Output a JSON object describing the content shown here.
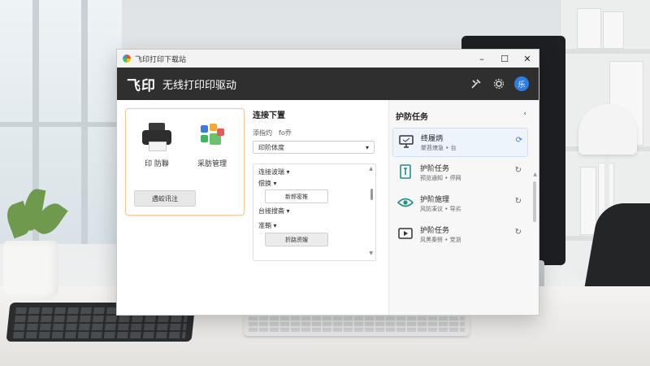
{
  "window": {
    "title": "飞印打印下载站",
    "controls": {
      "minimize": "–",
      "maximize": "☐",
      "close": "✕"
    }
  },
  "header": {
    "brand": "飞印",
    "subtitle": "无线打印印驱动",
    "icons": [
      "tools-icon",
      "gear-icon"
    ],
    "avatar_text": "乐"
  },
  "left_card": {
    "tiles": [
      {
        "label": "印 防聯",
        "icon": "printer-icon"
      },
      {
        "label": "采肪管理",
        "icon": "apps-icon"
      }
    ],
    "status_button": "遇蛟讯注"
  },
  "middle": {
    "heading": "连接下置",
    "row_labels": {
      "left": "添指灼",
      "right": "fo乔"
    },
    "select_value": "印阶体度",
    "box": {
      "line1": "连接波瑞",
      "line2": "偿换",
      "btn1": "新郎密推",
      "line3": "台接搜斋",
      "line4": "准鞘",
      "btn2": "折路资嫂"
    }
  },
  "right": {
    "heading": "护防任务",
    "collapse_glyph": "‹",
    "tasks": [
      {
        "title": "终履炳",
        "subtitle": "聚苕燎急 • 台",
        "icon": "monitor-icon",
        "status": "⟳",
        "active": true
      },
      {
        "title": "护阶任务",
        "subtitle": "预览通知 • 停网",
        "icon": "document-icon",
        "status": "↻",
        "active": false
      },
      {
        "title": "护阶施理",
        "subtitle": "风防凑议 • 导劣",
        "icon": "eye-icon",
        "status": "↻",
        "active": false
      },
      {
        "title": "护阶任务",
        "subtitle": "风黑秦劈 • 党浙",
        "icon": "play-icon",
        "status": "↻",
        "active": false
      }
    ]
  },
  "colors": {
    "header_bg": "#2f2f2f",
    "accent_blue": "#2f7de1",
    "card_border": "#f0c89a",
    "teal": "#1f8f8a"
  }
}
